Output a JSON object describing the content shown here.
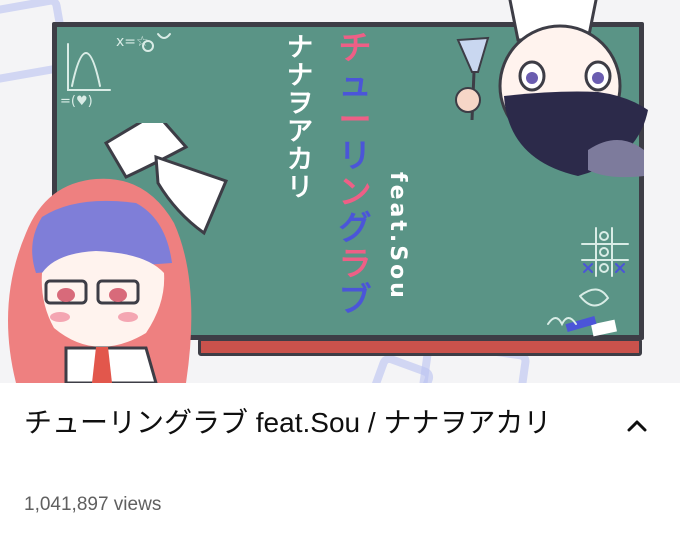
{
  "video": {
    "title": "チューリングラブ feat.Sou / ナナヲアカリ",
    "views": "1,041,897 views"
  },
  "thumbnail": {
    "title_chars": [
      "チ",
      "ュ",
      "ー",
      "リ",
      "ン",
      "グ",
      "ラ",
      "ブ"
    ],
    "artist_chars": [
      "ナ",
      "ナ",
      "ヲ",
      "ア",
      "カ",
      "リ"
    ],
    "feat_text": "feat.Sou",
    "board_notes": [
      "x=☆",
      "=(♥)"
    ]
  },
  "icons": {
    "expand": "chevron-up-icon"
  },
  "colors": {
    "board": "#5a9486",
    "title_text": "#0f0f0f",
    "meta_text": "#606060",
    "accent_pink": "#ee5f86",
    "accent_blue": "#4b55d8"
  }
}
